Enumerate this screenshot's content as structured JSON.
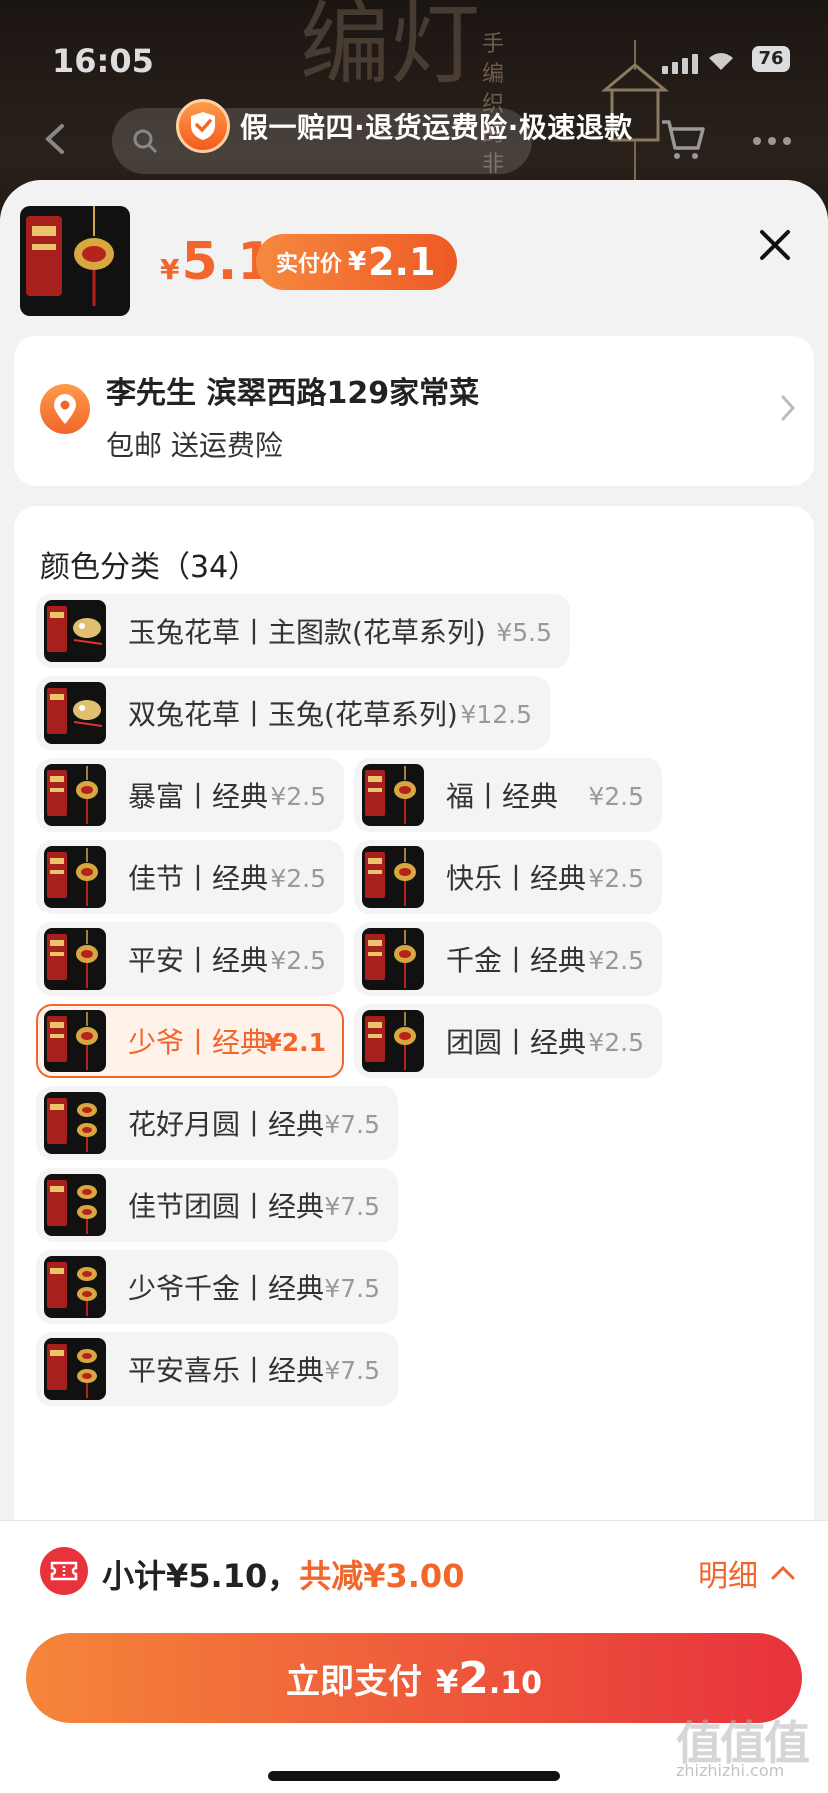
{
  "status_bar": {
    "time": "16:05",
    "battery": "76"
  },
  "background": {
    "art_chars": "编灯",
    "vertical_text": "手编织的非文化"
  },
  "banner": {
    "text": "假一赔四·退货运费险·极速退款"
  },
  "header": {
    "price_yen": "¥",
    "price": "5.1",
    "paid_label": "实付价",
    "paid_yen": "¥",
    "paid_value": "2.1"
  },
  "address": {
    "name_line": "李先生 滨翠西路129家常菜",
    "sub_line": "包邮 送运费险"
  },
  "options": {
    "title": "颜色分类（34）",
    "items": [
      {
        "name": "玉兔花草丨主图款(花草系列)",
        "price": "¥5.5",
        "selected": false,
        "thumb": "rabbit"
      },
      {
        "name": "双兔花草丨玉兔(花草系列)",
        "price": "¥12.5",
        "selected": false,
        "thumb": "rabbit"
      },
      {
        "name": "暴富丨经典",
        "price": "¥2.5",
        "selected": false,
        "thumb": "lantern"
      },
      {
        "name": "福丨经典",
        "price": "¥2.5",
        "selected": false,
        "thumb": "lantern"
      },
      {
        "name": "佳节丨经典",
        "price": "¥2.5",
        "selected": false,
        "thumb": "lantern"
      },
      {
        "name": "快乐丨经典",
        "price": "¥2.5",
        "selected": false,
        "thumb": "lantern"
      },
      {
        "name": "平安丨经典",
        "price": "¥2.5",
        "selected": false,
        "thumb": "lantern"
      },
      {
        "name": "千金丨经典",
        "price": "¥2.5",
        "selected": false,
        "thumb": "lantern"
      },
      {
        "name": "少爷丨经典",
        "price": "¥2.1",
        "selected": true,
        "thumb": "lantern"
      },
      {
        "name": "团圆丨经典",
        "price": "¥2.5",
        "selected": false,
        "thumb": "lantern"
      },
      {
        "name": "花好月圆丨经典",
        "price": "¥7.5",
        "selected": false,
        "thumb": "double"
      },
      {
        "name": "佳节团圆丨经典",
        "price": "¥7.5",
        "selected": false,
        "thumb": "double"
      },
      {
        "name": "少爷千金丨经典",
        "price": "¥7.5",
        "selected": false,
        "thumb": "double"
      },
      {
        "name": "平安喜乐丨经典",
        "price": "¥7.5",
        "selected": false,
        "thumb": "double"
      }
    ]
  },
  "bottom": {
    "subtotal": "小计¥5.10，",
    "discount": "共减¥3.00",
    "detail": "明细",
    "pay_label": "立即支付",
    "pay_yen": "¥",
    "pay_int": "2",
    "pay_dec": ".10"
  },
  "watermark": {
    "main": "值值值",
    "sub": "zhizhizhi.com"
  },
  "colors": {
    "accent": "#f2652b",
    "pay_gradient_end": "#e8323c",
    "chip_bg": "#f4f4f5"
  }
}
